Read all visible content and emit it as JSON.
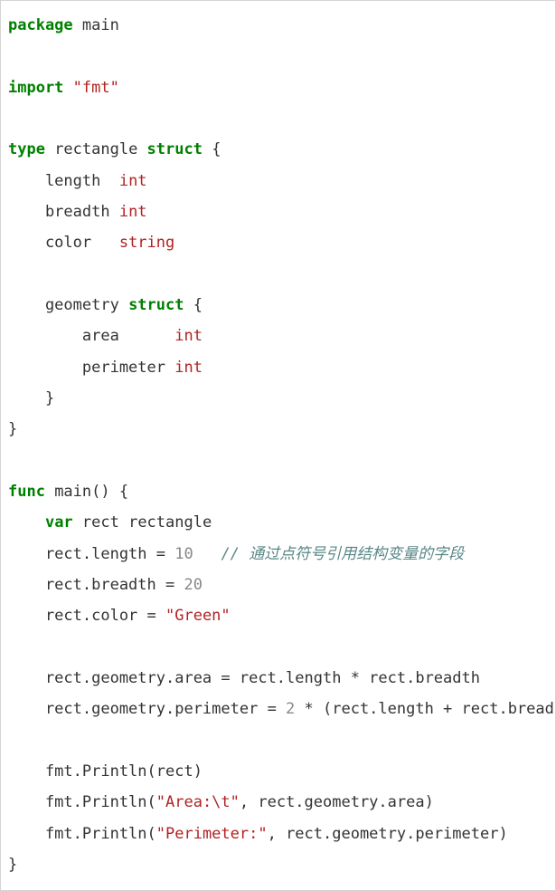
{
  "code": {
    "tokens": [
      {
        "t": "kw",
        "v": "package"
      },
      {
        "t": "plain",
        "v": " main"
      },
      {
        "t": "br"
      },
      {
        "t": "br"
      },
      {
        "t": "kw",
        "v": "import"
      },
      {
        "t": "plain",
        "v": " "
      },
      {
        "t": "str",
        "v": "\"fmt\""
      },
      {
        "t": "br"
      },
      {
        "t": "br"
      },
      {
        "t": "kw",
        "v": "type"
      },
      {
        "t": "plain",
        "v": " rectangle "
      },
      {
        "t": "kw",
        "v": "struct"
      },
      {
        "t": "plain",
        "v": " {"
      },
      {
        "t": "br"
      },
      {
        "t": "plain",
        "v": "    length  "
      },
      {
        "t": "type-name",
        "v": "int"
      },
      {
        "t": "br"
      },
      {
        "t": "plain",
        "v": "    breadth "
      },
      {
        "t": "type-name",
        "v": "int"
      },
      {
        "t": "br"
      },
      {
        "t": "plain",
        "v": "    color   "
      },
      {
        "t": "type-name",
        "v": "string"
      },
      {
        "t": "br"
      },
      {
        "t": "br"
      },
      {
        "t": "plain",
        "v": "    geometry "
      },
      {
        "t": "kw",
        "v": "struct"
      },
      {
        "t": "plain",
        "v": " {"
      },
      {
        "t": "br"
      },
      {
        "t": "plain",
        "v": "        area      "
      },
      {
        "t": "type-name",
        "v": "int"
      },
      {
        "t": "br"
      },
      {
        "t": "plain",
        "v": "        perimeter "
      },
      {
        "t": "type-name",
        "v": "int"
      },
      {
        "t": "br"
      },
      {
        "t": "plain",
        "v": "    }"
      },
      {
        "t": "br"
      },
      {
        "t": "plain",
        "v": "}"
      },
      {
        "t": "br"
      },
      {
        "t": "br"
      },
      {
        "t": "kw",
        "v": "func"
      },
      {
        "t": "plain",
        "v": " main() {"
      },
      {
        "t": "br"
      },
      {
        "t": "plain",
        "v": "    "
      },
      {
        "t": "kw",
        "v": "var"
      },
      {
        "t": "plain",
        "v": " rect rectangle"
      },
      {
        "t": "br"
      },
      {
        "t": "plain",
        "v": "    rect.length = "
      },
      {
        "t": "num",
        "v": "10"
      },
      {
        "t": "plain",
        "v": "   "
      },
      {
        "t": "comment",
        "v": "// 通过点符号引用结构变量的字段"
      },
      {
        "t": "br"
      },
      {
        "t": "plain",
        "v": "    rect.breadth = "
      },
      {
        "t": "num",
        "v": "20"
      },
      {
        "t": "br"
      },
      {
        "t": "plain",
        "v": "    rect.color = "
      },
      {
        "t": "str",
        "v": "\"Green\""
      },
      {
        "t": "br"
      },
      {
        "t": "br"
      },
      {
        "t": "plain",
        "v": "    rect.geometry.area = rect.length * rect.breadth"
      },
      {
        "t": "br"
      },
      {
        "t": "plain",
        "v": "    rect.geometry.perimeter = "
      },
      {
        "t": "num",
        "v": "2"
      },
      {
        "t": "plain",
        "v": " * (rect.length + rect.breadth)"
      },
      {
        "t": "br"
      },
      {
        "t": "br"
      },
      {
        "t": "plain",
        "v": "    fmt.Println(rect)"
      },
      {
        "t": "br"
      },
      {
        "t": "plain",
        "v": "    fmt.Println("
      },
      {
        "t": "str",
        "v": "\"Area:\\t\""
      },
      {
        "t": "plain",
        "v": ", rect.geometry.area)"
      },
      {
        "t": "br"
      },
      {
        "t": "plain",
        "v": "    fmt.Println("
      },
      {
        "t": "str",
        "v": "\"Perimeter:\""
      },
      {
        "t": "plain",
        "v": ", rect.geometry.perimeter)"
      },
      {
        "t": "br"
      },
      {
        "t": "plain",
        "v": "}"
      }
    ]
  }
}
